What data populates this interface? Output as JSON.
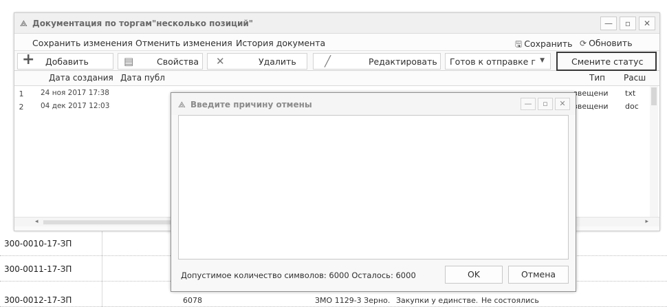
{
  "window": {
    "title": "Документация по торгам\"несколько позиций\"",
    "controls": {
      "minimize": "—",
      "maximize": "▫",
      "close": "✕"
    }
  },
  "menu": {
    "save_changes": "Сохранить изменения",
    "cancel_changes": "Отменить изменения",
    "history": "История документа",
    "save": "Сохранить",
    "refresh": "Обновить"
  },
  "toolbar": {
    "add": "Добавить",
    "properties": "Свойства",
    "delete": "Удалить",
    "edit": "Редактировать",
    "status_value": "Готов к отправке г",
    "change_status": "Смените статус"
  },
  "grid": {
    "columns": [
      "Дата создания",
      "Дата публ",
      "Тип",
      "Расш"
    ],
    "rows": [
      {
        "n": "1",
        "created": "24 ноя 2017 17:38",
        "type": "звещени",
        "ext": "txt"
      },
      {
        "n": "2",
        "created": "04 дек 2017 12:03",
        "type": "звещени",
        "ext": "doc"
      }
    ]
  },
  "dialog": {
    "title": "Введите причину отмены",
    "text_value": "",
    "counter": "Допустимое количество символов: 6000 Осталось: 6000",
    "ok": "OK",
    "cancel": "Отмена"
  },
  "background_rows": [
    {
      "id": "300-0010-17-ЗП",
      "num": "",
      "name": "",
      "type": "",
      "status": ""
    },
    {
      "id": "300-0011-17-ЗП",
      "num": "",
      "name": "",
      "type": "",
      "status": ""
    },
    {
      "id": "300-0012-17-ЗП",
      "num": "6078",
      "name": "ЗМО 1129-3 Зерно..",
      "type": "Закупки у единстве..",
      "status": "Не состоялись"
    }
  ]
}
